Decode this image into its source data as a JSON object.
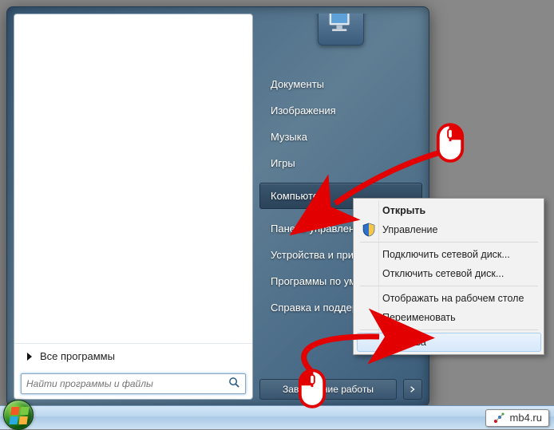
{
  "startMenu": {
    "allPrograms": "Все программы",
    "searchPlaceholder": "Найти программы и файлы",
    "shutdown": "Завершение работы",
    "items": [
      {
        "label": "Документы",
        "selected": false
      },
      {
        "label": "Изображения",
        "selected": false
      },
      {
        "label": "Музыка",
        "selected": false
      },
      {
        "label": "Игры",
        "selected": false
      },
      {
        "label": "Компьютер",
        "selected": true
      },
      {
        "label": "Панель управления",
        "selected": false
      },
      {
        "label": "Устройства и принтеры",
        "selected": false
      },
      {
        "label": "Программы по умолчанию",
        "selected": false
      },
      {
        "label": "Справка и поддержка",
        "selected": false
      }
    ]
  },
  "contextMenu": {
    "items": [
      {
        "label": "Открыть",
        "bold": true
      },
      {
        "label": "Управление",
        "icon": "shield-icon"
      },
      {
        "sep": true
      },
      {
        "label": "Подключить сетевой диск..."
      },
      {
        "label": "Отключить сетевой диск..."
      },
      {
        "sep": true
      },
      {
        "label": "Отображать на рабочем столе"
      },
      {
        "label": "Переименовать"
      },
      {
        "sep": true
      },
      {
        "label": "Свойства",
        "hover": true
      }
    ]
  },
  "watermark": "mb4.ru",
  "icons": {
    "computer": "computer-icon",
    "search": "search-icon",
    "shield": "shield-icon"
  },
  "colors": {
    "startMenuBg": "#4a6b87",
    "contextHover": "#d6e8fb",
    "annotationRed": "#e20000"
  }
}
